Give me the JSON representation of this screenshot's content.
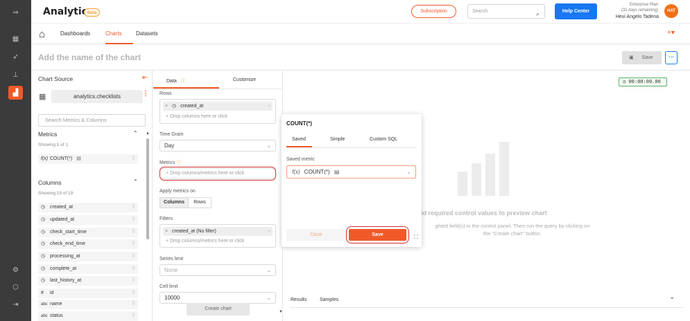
{
  "app": {
    "title": "Analytics",
    "badge": "Beta"
  },
  "topbar": {
    "subscription": "Subscription",
    "search_placeholder": "Search",
    "help": "Help Center",
    "plan": "Enterprise Plan",
    "plan_days": "(31 days remaining)",
    "user": "Hevi Angelo Tadena",
    "avatar": "HAT"
  },
  "nav": {
    "tabs": [
      "Dashboards",
      "Charts",
      "Datasets"
    ],
    "active": "Charts"
  },
  "titlebar": {
    "chart_name_placeholder": "Add the name of the chart",
    "save": "Save",
    "more": "···"
  },
  "left": {
    "title": "Chart Source",
    "dataset": "analytics.checklists",
    "search_placeholder": "Search Metrics & Columns",
    "metrics_title": "Metrics",
    "metrics_count": "Showing 1 of 1",
    "metrics": [
      {
        "icon": "f(x)",
        "label": "COUNT(*)"
      }
    ],
    "columns_title": "Columns",
    "columns_count": "Showing 19 of 19",
    "columns": [
      {
        "icon": "clock",
        "label": "created_at"
      },
      {
        "icon": "clock",
        "label": "updated_at"
      },
      {
        "icon": "clock",
        "label": "check_start_time"
      },
      {
        "icon": "clock",
        "label": "check_end_time"
      },
      {
        "icon": "clock",
        "label": "processing_at"
      },
      {
        "icon": "clock",
        "label": "complete_at"
      },
      {
        "icon": "clock",
        "label": "last_history_at"
      },
      {
        "icon": "#",
        "label": "id"
      },
      {
        "icon": "abc",
        "label": "name"
      },
      {
        "icon": "abc",
        "label": "status"
      }
    ]
  },
  "middle": {
    "tabs": [
      "Data",
      "Customize"
    ],
    "rows_label": "Rows",
    "rows_chip": "created_at",
    "rows_drop": "Drop columns here or click",
    "time_grain_label": "Time Grain",
    "time_grain": "Day",
    "metrics_label": "Metrics",
    "metrics_drop": "Drop columns/metrics here or click",
    "apply_label": "Apply metrics on",
    "apply_options": [
      "Columns",
      "Rows"
    ],
    "filters_label": "Filters",
    "filters_chip": "created_at (No filter)",
    "filters_drop": "Drop columns/metrics here or click",
    "series_label": "Series limit",
    "series_value": "None",
    "cell_label": "Cell limit",
    "cell_value": "10000",
    "create": "Create chart"
  },
  "right": {
    "timer": "00:00:00.00",
    "empty_title": "dd required control values to preview chart",
    "empty_line1": "ghted field(s) in the control panel. Then run the query by clicking on",
    "empty_line2": "the \"Create chart\" button.",
    "result_tabs": [
      "Results",
      "Samples"
    ]
  },
  "popover": {
    "title": "COUNT(*)",
    "tabs": [
      "Saved",
      "Simple",
      "Custom SQL"
    ],
    "saved_label": "Saved metric",
    "saved_value": "COUNT(*)",
    "close": "Close",
    "save": "Save"
  },
  "colors": {
    "accent": "#f05a28",
    "primary": "#1877f2",
    "rail": "#3b3b3b",
    "highlight": "#d32f2f"
  }
}
